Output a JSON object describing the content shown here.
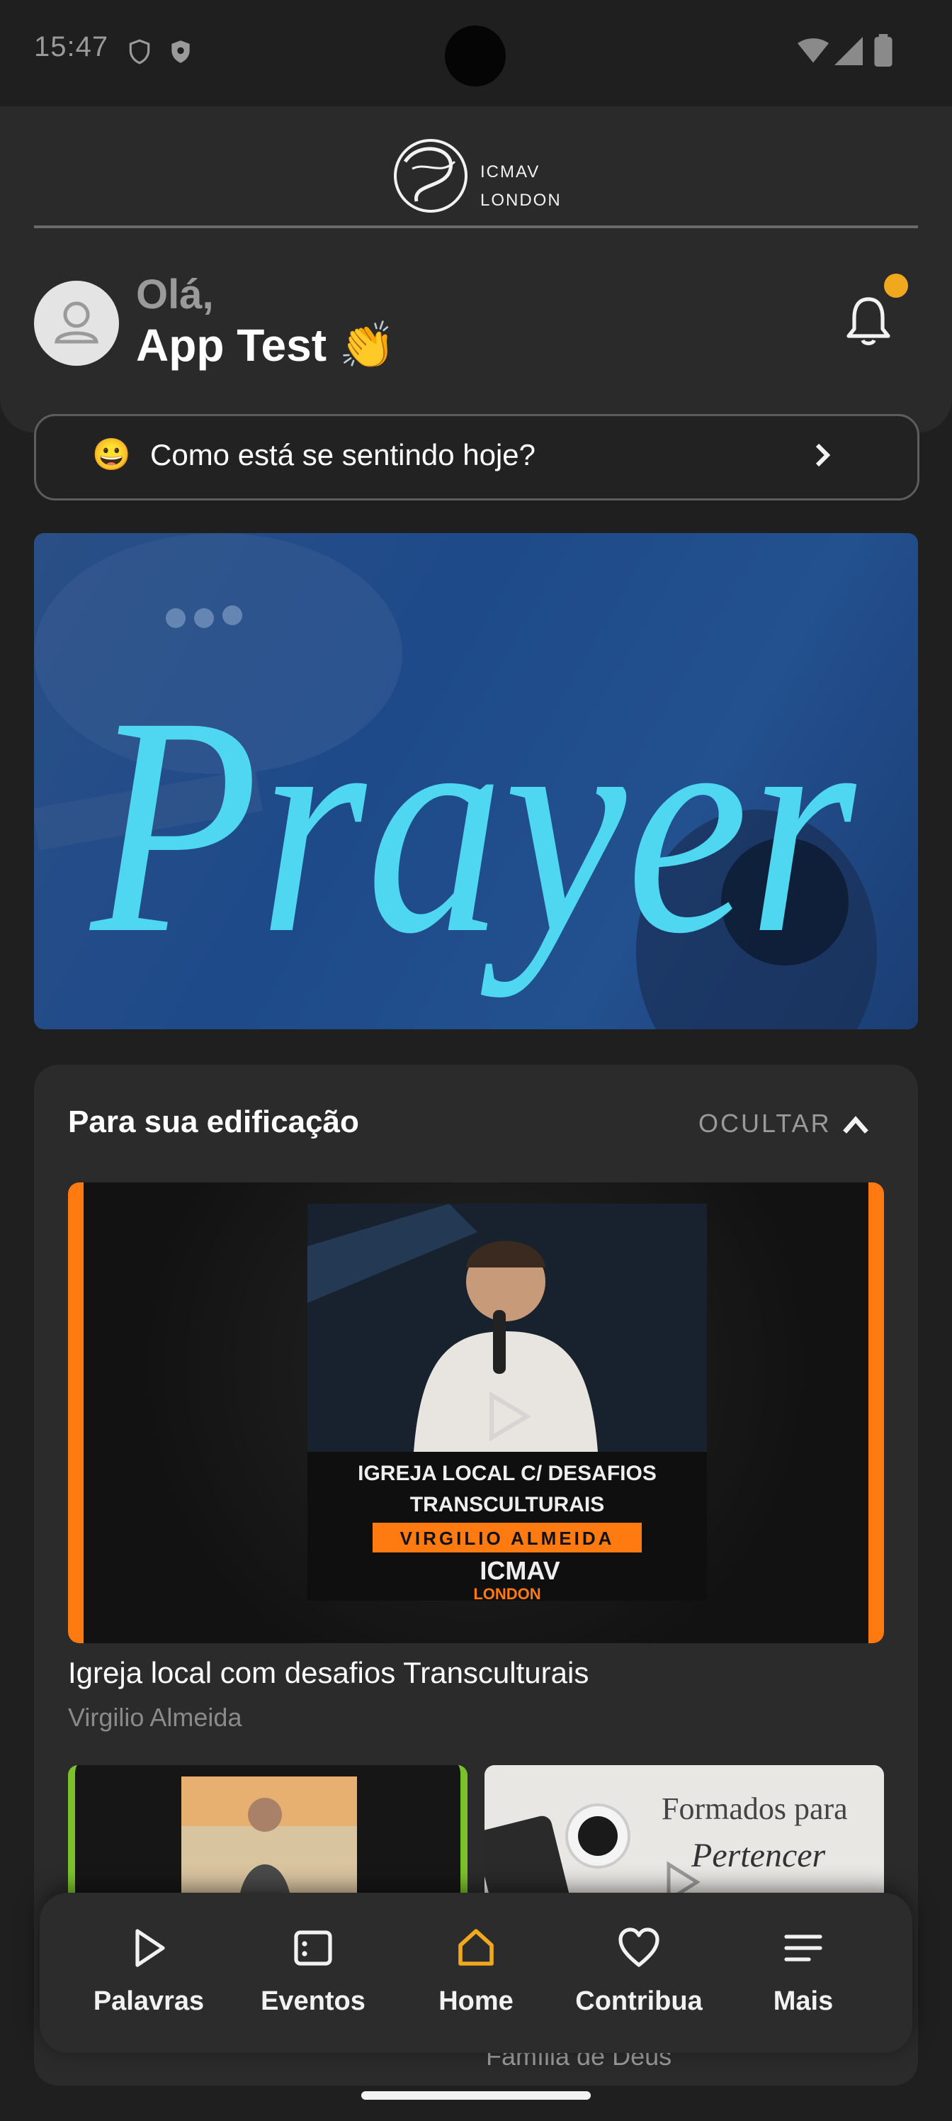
{
  "status_bar": {
    "time": "15:47"
  },
  "brand": {
    "line1": "ICMAV",
    "line2": "LONDON"
  },
  "greeting": {
    "hello": "Olá,",
    "name": "App Test 👏"
  },
  "mood_prompt": {
    "emoji": "😀",
    "text": "Como está se sentindo hoje?"
  },
  "banner": {
    "word": "Prayer"
  },
  "edification": {
    "title": "Para sua edificação",
    "hide_label": "OCULTAR",
    "featured": {
      "poster_title_line1": "IGREJA LOCAL C/ DESAFIOS",
      "poster_title_line2": "TRANSCULTURAIS",
      "poster_speaker": "VIRGILIO ALMEIDA",
      "poster_brand": "ICMAV",
      "poster_brand_sub": "LONDON",
      "title": "Igreja local com desafios Transculturais",
      "author": "Virgilio Almeida"
    },
    "second_thumb_line1": "Formados para",
    "second_thumb_line2": "Pertencer",
    "partial_caption": "Família de Deus"
  },
  "nav": [
    {
      "label": "Palavras",
      "icon": "play-icon"
    },
    {
      "label": "Eventos",
      "icon": "calendar-icon"
    },
    {
      "label": "Home",
      "icon": "home-icon",
      "active": true
    },
    {
      "label": "Contribua",
      "icon": "heart-icon"
    },
    {
      "label": "Mais",
      "icon": "menu-icon"
    }
  ],
  "colors": {
    "accent": "#f0a81e",
    "video_stripe": "#ff7a10",
    "banner_text": "#4fd6f0"
  }
}
